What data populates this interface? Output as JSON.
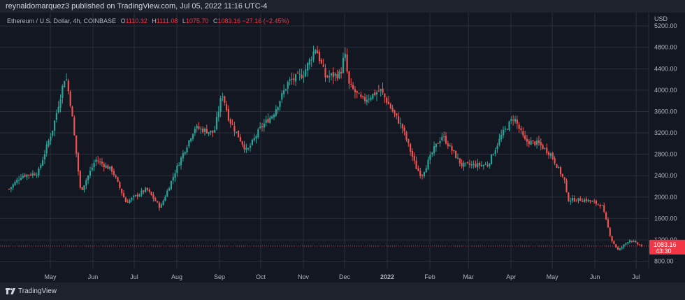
{
  "header": {
    "published": "reynaldomarquez3 published on TradingView.com, Jul 05, 2022 11:16 UTC-4"
  },
  "legend": {
    "symbol": "Ethereum / U.S. Dollar, 4h, COINBASE",
    "open_label": "O",
    "open": "1110.32",
    "high_label": "H",
    "high": "1111.08",
    "low_label": "L",
    "low": "1075.70",
    "close_label": "C",
    "close": "1083.16",
    "change": "−27.16 (−2.45%)"
  },
  "price_tag": {
    "price": "1083.16",
    "countdown": "43:30"
  },
  "footer": {
    "brand": "TradingView"
  },
  "colors": {
    "up": "#26a69a",
    "down": "#ef5350",
    "background": "#131722",
    "grid": "#2a2e39",
    "tag": "#f23645"
  },
  "chart_data": {
    "type": "candlestick",
    "title": "",
    "y_axis_label": "USD",
    "y_ticks": [
      800,
      1200,
      1600,
      2000,
      2400,
      2800,
      3200,
      3600,
      4000,
      4400,
      4800,
      5200
    ],
    "ylim": [
      650,
      5450
    ],
    "x_ticks": [
      "May",
      "Jun",
      "Jul",
      "Aug",
      "Sep",
      "Oct",
      "Nov",
      "Dec",
      "2022",
      "Feb",
      "Mar",
      "Apr",
      "May",
      "Jun",
      "Jul"
    ],
    "grid": true,
    "price_line": 1083.16,
    "series": [
      {
        "date": "2021-04-01",
        "close": 2150
      },
      {
        "date": "2021-04-10",
        "close": 2400
      },
      {
        "date": "2021-04-22",
        "close": 2450
      },
      {
        "date": "2021-05-03",
        "close": 3300
      },
      {
        "date": "2021-05-12",
        "close": 4300
      },
      {
        "date": "2021-05-16",
        "close": 3700
      },
      {
        "date": "2021-05-23",
        "close": 2100
      },
      {
        "date": "2021-06-03",
        "close": 2700
      },
      {
        "date": "2021-06-15",
        "close": 2500
      },
      {
        "date": "2021-06-25",
        "close": 1900
      },
      {
        "date": "2021-07-10",
        "close": 2150
      },
      {
        "date": "2021-07-20",
        "close": 1800
      },
      {
        "date": "2021-08-01",
        "close": 2550
      },
      {
        "date": "2021-08-14",
        "close": 3300
      },
      {
        "date": "2021-08-28",
        "close": 3200
      },
      {
        "date": "2021-09-03",
        "close": 3950
      },
      {
        "date": "2021-09-08",
        "close": 3450
      },
      {
        "date": "2021-09-21",
        "close": 2850
      },
      {
        "date": "2021-10-01",
        "close": 3300
      },
      {
        "date": "2021-10-10",
        "close": 3550
      },
      {
        "date": "2021-10-21",
        "close": 4150
      },
      {
        "date": "2021-11-01",
        "close": 4300
      },
      {
        "date": "2021-11-10",
        "close": 4800
      },
      {
        "date": "2021-11-17",
        "close": 4250
      },
      {
        "date": "2021-11-28",
        "close": 4300
      },
      {
        "date": "2021-12-01",
        "close": 4700
      },
      {
        "date": "2021-12-04",
        "close": 4100
      },
      {
        "date": "2021-12-14",
        "close": 3800
      },
      {
        "date": "2021-12-27",
        "close": 4000
      },
      {
        "date": "2022-01-05",
        "close": 3600
      },
      {
        "date": "2022-01-12",
        "close": 3300
      },
      {
        "date": "2022-01-22",
        "close": 2550
      },
      {
        "date": "2022-01-26",
        "close": 2400
      },
      {
        "date": "2022-02-04",
        "close": 2900
      },
      {
        "date": "2022-02-10",
        "close": 3150
      },
      {
        "date": "2022-02-24",
        "close": 2600
      },
      {
        "date": "2022-03-06",
        "close": 2600
      },
      {
        "date": "2022-03-15",
        "close": 2600
      },
      {
        "date": "2022-03-25",
        "close": 3150
      },
      {
        "date": "2022-04-03",
        "close": 3500
      },
      {
        "date": "2022-04-11",
        "close": 3050
      },
      {
        "date": "2022-04-21",
        "close": 3000
      },
      {
        "date": "2022-04-30",
        "close": 2800
      },
      {
        "date": "2022-05-10",
        "close": 2300
      },
      {
        "date": "2022-05-12",
        "close": 1950
      },
      {
        "date": "2022-05-25",
        "close": 1950
      },
      {
        "date": "2022-06-06",
        "close": 1850
      },
      {
        "date": "2022-06-13",
        "close": 1200
      },
      {
        "date": "2022-06-18",
        "close": 1000
      },
      {
        "date": "2022-06-26",
        "close": 1200
      },
      {
        "date": "2022-07-05",
        "close": 1083
      }
    ]
  }
}
